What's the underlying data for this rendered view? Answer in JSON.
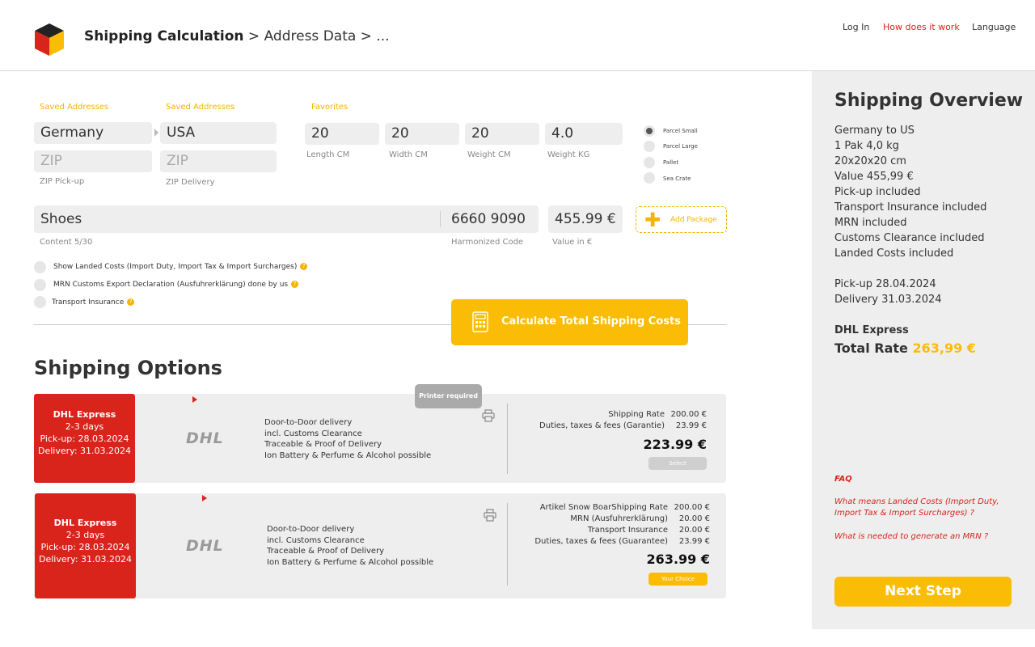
{
  "header": {
    "breadcrumb_current": "Shipping Calculation",
    "breadcrumb_rest": " > Address Data > ...",
    "nav": {
      "login": "Log In",
      "how": "How does it work",
      "language": "Language"
    }
  },
  "form": {
    "saved_addresses_1": "Saved Addresses",
    "saved_addresses_2": "Saved Addresses",
    "favorites": "Favorites",
    "from_country": "Germany",
    "to_country": "USA",
    "zip_pickup_placeholder": "ZIP",
    "zip_delivery_placeholder": "ZIP",
    "zip_pickup_label": "ZIP Pick-up",
    "zip_delivery_label": "ZIP Delivery",
    "length": "20",
    "width": "20",
    "weight_cm": "20",
    "weight_kg": "4.0",
    "length_label": "Length CM",
    "width_label": "Width CM",
    "weight_cm_label": "Weight CM",
    "weight_kg_label": "Weight KG",
    "package_types": [
      "Parcel Small",
      "Parcel Large",
      "Pallet",
      "Sea Crate"
    ],
    "package_selected": 0,
    "content": "Shoes",
    "hs_code": "6660 9090",
    "value": "455.99 €",
    "content_label": "Content 5/30",
    "hs_label": "Harmonized Code",
    "value_label": "Value in €",
    "add_package": "Add Package",
    "options": [
      "Show Landed Costs (Import Duty, Import Tax & Import Surcharges)",
      "MRN Customs Export Declaration (Ausfuhrerklärung) done by us",
      "Transport Insurance"
    ],
    "calc_button": "Calculate Total Shipping Costs"
  },
  "shipping_options": {
    "title": "Shipping Options",
    "printer_required": "Printer required",
    "cards": [
      {
        "carrier": "DHL Express",
        "days": "2-3 days",
        "pickup": "Pick-up: 28.03.2024",
        "delivery": "Delivery: 31.03.2024",
        "logo": "DHL",
        "features": [
          "Door-to-Door delivery",
          "incl. Customs Clearance",
          "Traceable & Proof of Delivery",
          "Ion Battery & Perfume & Alcohol possible"
        ],
        "rates": [
          {
            "label": "Shipping Rate",
            "value": "200.00 €"
          },
          {
            "label": "Duties, taxes & fees (Garantie)",
            "value": "23.99 €"
          }
        ],
        "total": "223.99 €",
        "button": "Select"
      },
      {
        "carrier": "DHL Express",
        "days": "2-3 days",
        "pickup": "Pick-up: 28.03.2024",
        "delivery": "Delivery: 31.03.2024",
        "logo": "DHL",
        "features": [
          "Door-to-Door delivery",
          "incl. Customs Clearance",
          "Traceable & Proof of Delivery",
          "Ion Battery & Perfume & Alcohol possible"
        ],
        "rates": [
          {
            "label": "Artikel Snow BoarShipping Rate",
            "value": "200.00 €"
          },
          {
            "label": "MRN (Ausfuhrerklärung)",
            "value": "20.00 €"
          },
          {
            "label": "Transport Insurance",
            "value": "20.00 €"
          },
          {
            "label": "Duties, taxes & fees (Guarantee)",
            "value": "23.99 €"
          }
        ],
        "total": "263.99 €",
        "button": "Your Choice"
      }
    ]
  },
  "overview": {
    "title": "Shipping Overview",
    "lines": [
      "Germany to US",
      "1 Pak 4,0 kg",
      "20x20x20 cm",
      "Value 455,99 €",
      "Pick-up included",
      "Transport Insurance included",
      "MRN included",
      "Customs Clearance included",
      "Landed Costs included"
    ],
    "pickup": "Pick-up 28.04.2024",
    "delivery": "Delivery 31.03.2024",
    "carrier": "DHL Express",
    "total_label": "Total Rate",
    "total_value": "263,99 €",
    "faq_title": "FAQ",
    "faq_1": "What means Landed Costs (Import Duty, Import Tax & Import Surcharges) ?",
    "faq_2": "What is needed to generate an MRN ?",
    "next_button": "Next Step"
  },
  "colors": {
    "accent": "#fbbc05",
    "brand_red": "#d8241b",
    "panel": "#eeeeee"
  }
}
